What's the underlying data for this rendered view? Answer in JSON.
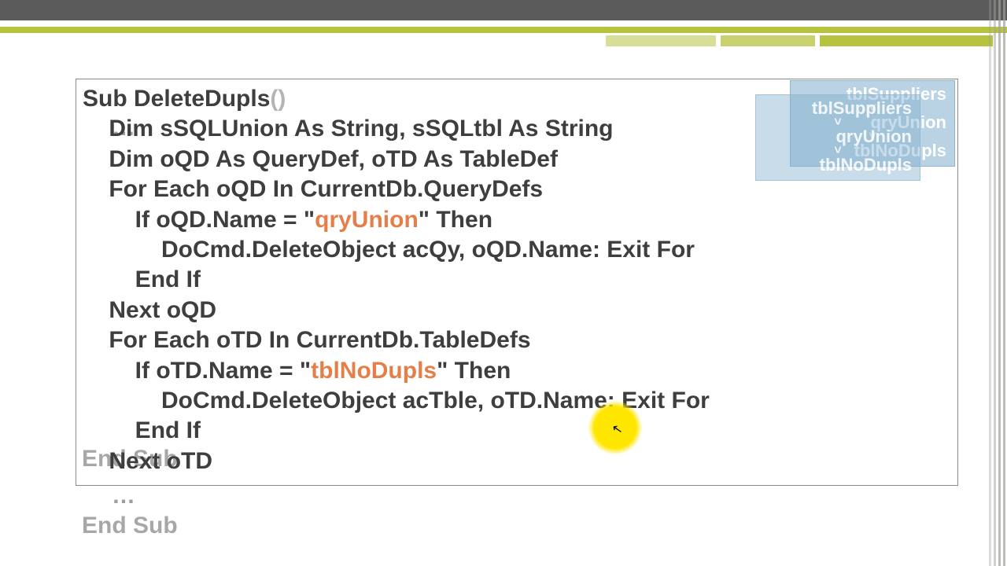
{
  "code": {
    "l1a": "Sub DeleteDupls",
    "l1b": "()",
    "l2": "    Dim sSQLUnion As String, sSQLtbl As String",
    "l3": "    Dim oQD As QueryDef, oTD As TableDef",
    "l4": "    For Each oQD In CurrentDb.QueryDefs",
    "l5a": "        If oQD.Name = \"",
    "l5h": "qryUnion",
    "l5b": "\" Then",
    "l6": "            DoCmd.DeleteObject acQy, oQD.Name: Exit For",
    "l7": "        End If",
    "l8": "    Next oQD",
    "l9": "    For Each oTD In CurrentDb.TableDefs",
    "l10a": "        If oTD.Name = \"",
    "l10h": "tblNoDupls",
    "l10b": "\" Then",
    "l11": "            DoCmd.DeleteObject acTble, oTD.Name: Exit For",
    "l12": "        End If",
    "l13": "    Next oTD"
  },
  "ghost": {
    "header": "Sub DeleteDupls()",
    "footer": "End Sub",
    "ellipsis": "…",
    "endsub": "End Sub"
  },
  "diagram": {
    "n1": "tblSuppliers",
    "n2": "qryUnion",
    "n3": "tblNoDupls",
    "arrow": "˅"
  }
}
